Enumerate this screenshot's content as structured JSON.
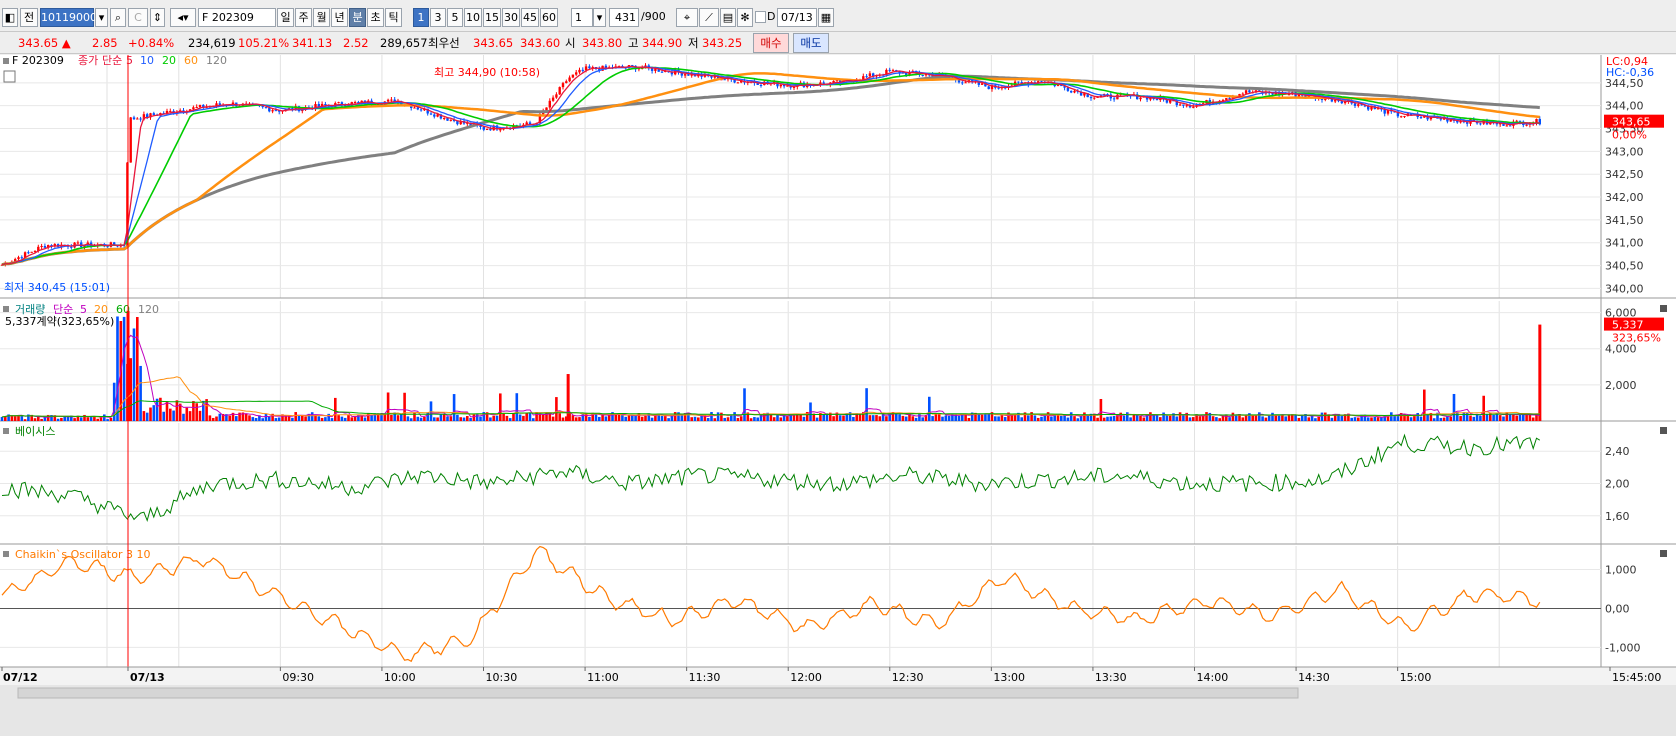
{
  "toolbar": {
    "code": "10119000",
    "symbol": "F 202309",
    "periods": [
      "일",
      "주",
      "월",
      "년",
      "분",
      "초",
      "틱"
    ],
    "minutes": [
      "1",
      "3",
      "5",
      "10",
      "15",
      "30",
      "45",
      "60"
    ],
    "interval": "1",
    "count": "431",
    "count_max": "/900",
    "date_checkbox": "D",
    "date": "07/13",
    "btn_jeon": "전",
    "btn_c": "C",
    "active_period": "분",
    "active_minute": "1"
  },
  "quote": {
    "price": "343.65 ▲",
    "change": "2.85",
    "change_pct": "+0.84%",
    "volume": "234,619",
    "volume_pct": "105.21%",
    "theory": "341.13",
    "basis": "2.52",
    "open_interest": "289,657",
    "best_label": "최우선",
    "ask": "343.65",
    "bid": "343.60",
    "open_label": "시",
    "open": "343.80",
    "high_label": "고",
    "high": "344.90",
    "low_label": "저",
    "low": "343.25",
    "buy": "매수",
    "sell": "매도"
  },
  "colors": {
    "up": "#ff0000",
    "down": "#0050ff",
    "ma5": "#e8173c",
    "ma10": "#1f5cff",
    "ma20": "#00cc00",
    "ma60": "#ff9010",
    "ma120": "#808080",
    "basis": "#008000",
    "chaikin": "#ff7a00"
  },
  "chart_data": [
    {
      "type": "candlestick",
      "title": "F 202309",
      "legend": [
        "종가",
        "단순",
        "5",
        "10",
        "20",
        "60",
        "120"
      ],
      "ylim": [
        339.9,
        345.0
      ],
      "yticks": [
        "344,50",
        "344,00",
        "343,50",
        "343,00",
        "342,50",
        "342,00",
        "341,50",
        "341,00",
        "340,50",
        "340,00"
      ],
      "last_label": "343,65",
      "last_pct": "0,00%",
      "lc_label": "LC:0,94",
      "hc_label": "HC:-0,36",
      "high_annotation": "최고 344,90 (10:58)",
      "low_annotation": "최저 340,45 (15:01)",
      "series_close": [
        {
          "t": "07/12 14:35",
          "v": 340.5
        },
        {
          "t": "07/12 15:00",
          "v": 340.95
        },
        {
          "t": "07/12 15:44",
          "v": 340.95
        },
        {
          "t": "07/13 08:45",
          "v": 343.7
        },
        {
          "t": "09:00",
          "v": 343.9
        },
        {
          "t": "09:15",
          "v": 344.05
        },
        {
          "t": "09:30",
          "v": 343.9
        },
        {
          "t": "09:50",
          "v": 344.05
        },
        {
          "t": "10:05",
          "v": 344.1
        },
        {
          "t": "10:20",
          "v": 343.7
        },
        {
          "t": "10:30",
          "v": 343.5
        },
        {
          "t": "10:45",
          "v": 343.6
        },
        {
          "t": "10:55",
          "v": 344.6
        },
        {
          "t": "11:00",
          "v": 344.8
        },
        {
          "t": "11:15",
          "v": 344.85
        },
        {
          "t": "11:30",
          "v": 344.7
        },
        {
          "t": "11:45",
          "v": 344.55
        },
        {
          "t": "12:00",
          "v": 344.45
        },
        {
          "t": "12:15",
          "v": 344.5
        },
        {
          "t": "12:30",
          "v": 344.75
        },
        {
          "t": "12:45",
          "v": 344.65
        },
        {
          "t": "13:00",
          "v": 344.4
        },
        {
          "t": "13:15",
          "v": 344.55
        },
        {
          "t": "13:30",
          "v": 344.2
        },
        {
          "t": "13:45",
          "v": 344.2
        },
        {
          "t": "14:00",
          "v": 344.0
        },
        {
          "t": "14:15",
          "v": 344.3
        },
        {
          "t": "14:30",
          "v": 344.25
        },
        {
          "t": "14:45",
          "v": 344.1
        },
        {
          "t": "15:00",
          "v": 343.8
        },
        {
          "t": "15:15",
          "v": 343.7
        },
        {
          "t": "15:30",
          "v": 343.6
        },
        {
          "t": "15:40",
          "v": 343.65
        }
      ]
    },
    {
      "type": "bar",
      "title": "거래량",
      "legend": [
        "거래량",
        "단순",
        "5",
        "20",
        "60",
        "120"
      ],
      "caption": "5,337계약(323,65%)",
      "ylim": [
        0,
        6200
      ],
      "yticks": [
        "6,000",
        "4,000",
        "2,000"
      ],
      "last_label": "5,337",
      "last_pct": "323,65%",
      "peaks": [
        {
          "t": "07/13 08:45",
          "v": 6100
        },
        {
          "t": "10:55",
          "v": 2600
        },
        {
          "t": "15:42",
          "v": 5337
        }
      ]
    },
    {
      "type": "line",
      "title": "베이시스",
      "ylim": [
        1.3,
        2.7
      ],
      "yticks": [
        "2,40",
        "2,00",
        "1,60"
      ],
      "series": [
        {
          "name": "베이시스",
          "values": [
            1.95,
            1.85,
            1.55,
            2.0,
            2.05,
            1.95,
            2.1,
            2.0,
            2.15,
            2.0,
            2.1,
            2.05,
            2.0,
            2.1,
            2.0,
            2.05,
            2.1,
            2.0,
            2.0,
            2.05,
            2.5,
            2.45,
            2.5
          ]
        }
      ]
    },
    {
      "type": "line",
      "title": "Chaikin`s Oscillator 3 10",
      "ylim": [
        -1400,
        1500
      ],
      "yticks": [
        "1,000",
        "0,00",
        "-1,000"
      ],
      "series": [
        {
          "name": "Chaikin`s Oscillator 3 10",
          "values": [
            300,
            1200,
            800,
            1300,
            400,
            -400,
            -1200,
            -800,
            1500,
            300,
            -300,
            200,
            -500,
            100,
            -400,
            800,
            0,
            -300,
            200,
            -200,
            500,
            -500,
            400,
            200
          ]
        }
      ]
    }
  ],
  "time_axis": [
    "07/12",
    "07/13",
    "09:30",
    "10:00",
    "10:30",
    "11:00",
    "11:30",
    "12:00",
    "12:30",
    "13:00",
    "13:30",
    "14:00",
    "14:30",
    "15:00",
    "15:45:00"
  ]
}
